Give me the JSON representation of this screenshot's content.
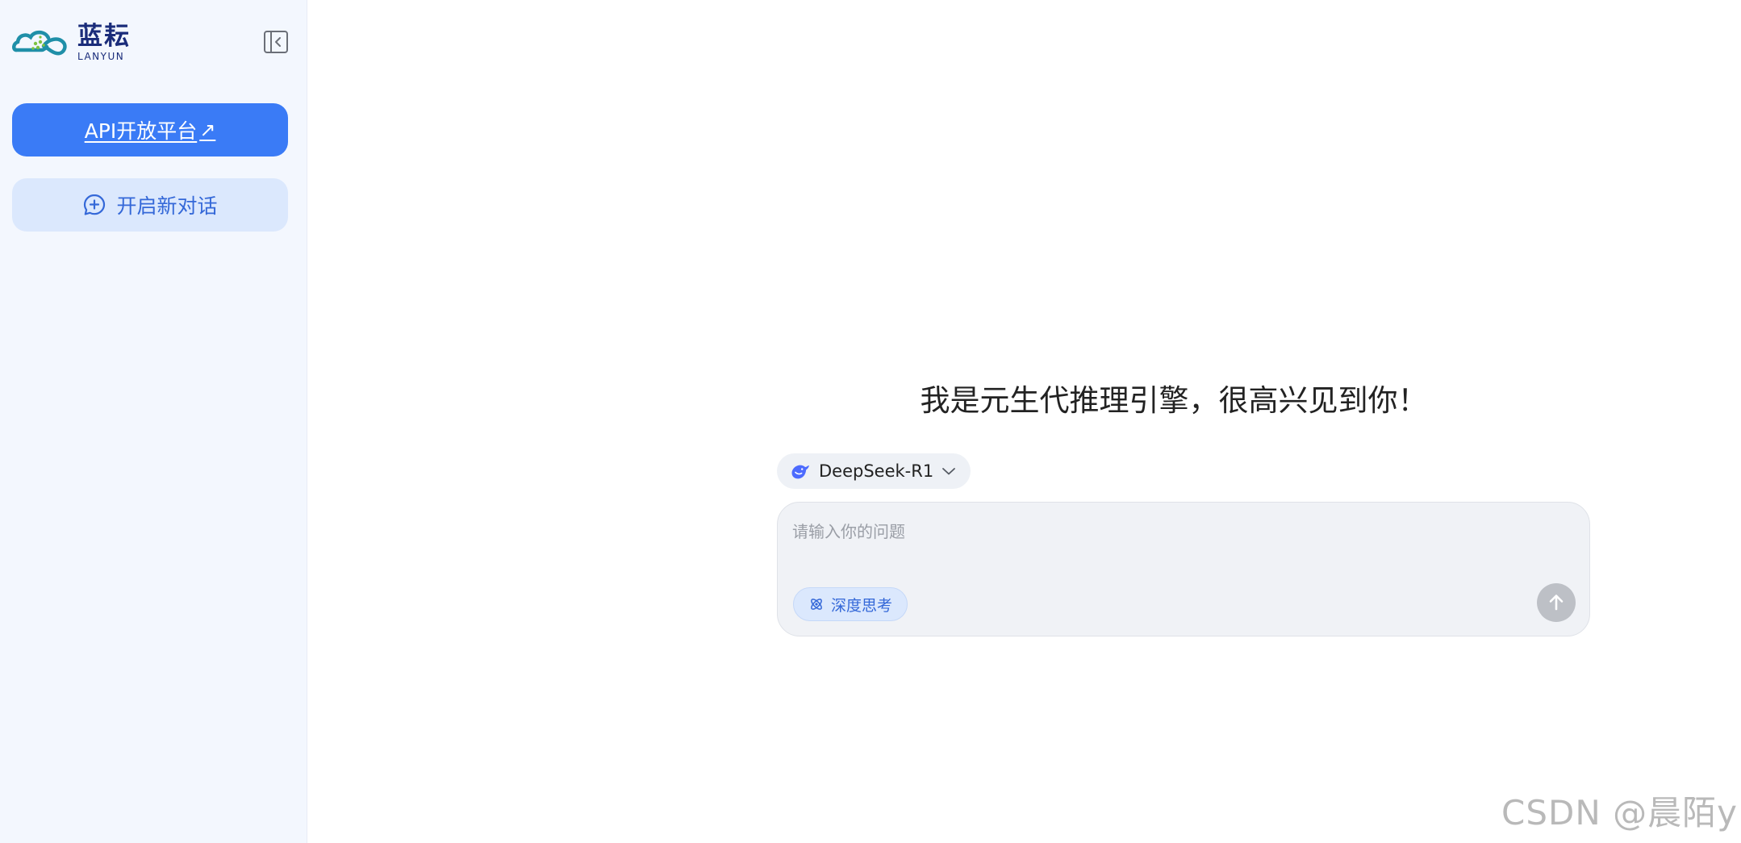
{
  "sidebar": {
    "logo": {
      "name_cn": "蓝耘",
      "name_en": "LANYUN"
    },
    "collapse_icon": "sidebar-collapse-icon",
    "api_button": {
      "label": "API开放平台",
      "icon": "external-link-arrow-icon"
    },
    "new_chat_button": {
      "label": "开启新对话",
      "icon": "chat-plus-icon"
    }
  },
  "main": {
    "welcome_text": "我是元生代推理引擎，很高兴见到你！",
    "model_selector": {
      "selected": "DeepSeek-R1",
      "icon": "deepseek-whale-icon",
      "dropdown_icon": "chevron-down-icon"
    },
    "composer": {
      "placeholder": "请输入你的问题",
      "value": "",
      "deep_think_label": "深度思考",
      "deep_think_icon": "atom-icon",
      "send_icon": "arrow-up-icon"
    }
  },
  "watermark": "CSDN @晨陌y",
  "colors": {
    "sidebar_bg": "#f3f7fe",
    "primary": "#3a7bf6",
    "secondary_bg": "#dbe8fd",
    "secondary_text": "#3468d8",
    "logo_text": "#1a2c7a",
    "send_disabled": "#bdc0c6"
  }
}
